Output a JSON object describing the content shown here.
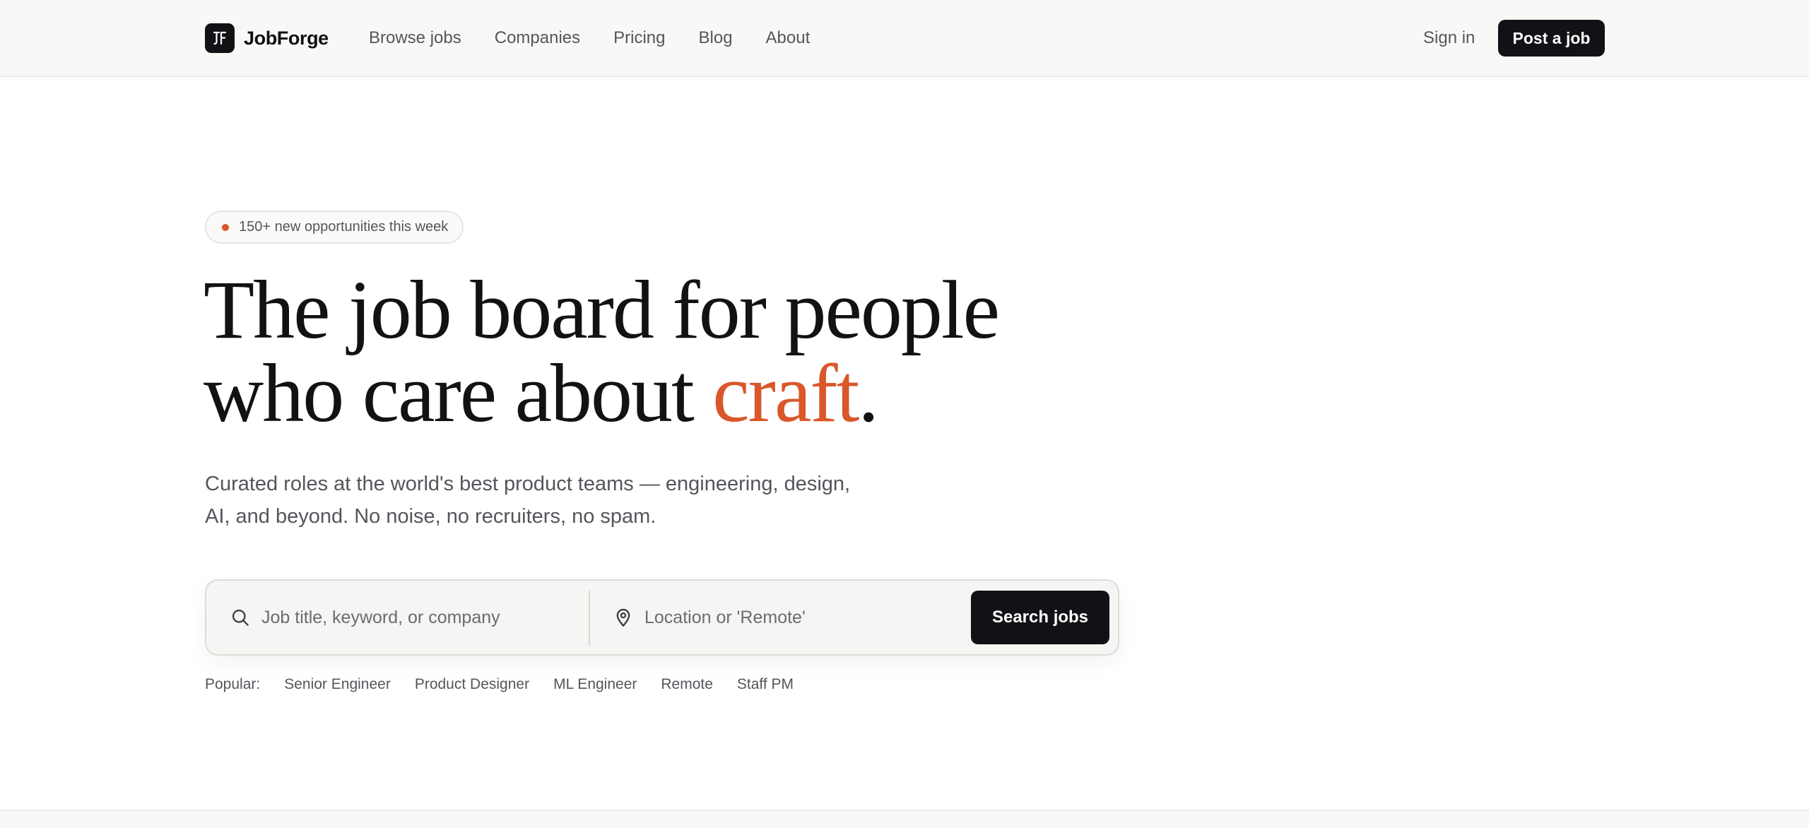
{
  "colors": {
    "accent": "#d9572a",
    "primary_dark": "#121216",
    "muted_text": "#55555c",
    "header_bg": "#f9f8f6"
  },
  "header": {
    "brand": {
      "logo_icon": "jf-monogram-icon",
      "name": "JobForge"
    },
    "nav": [
      {
        "label": "Browse jobs"
      },
      {
        "label": "Companies"
      },
      {
        "label": "Pricing"
      },
      {
        "label": "Blog"
      },
      {
        "label": "About"
      }
    ],
    "sign_in": "Sign in",
    "post_job": "Post a job"
  },
  "hero": {
    "badge": "150+ new opportunities this week",
    "headline_line1": "The job board for people",
    "headline_line2_pre": "who care about ",
    "headline_accent": "craft",
    "headline_end": ".",
    "subhead_line1": "Curated roles at the world's best product teams — engineering, design,",
    "subhead_line2": "AI, and beyond. No noise, no recruiters, no spam."
  },
  "search": {
    "keyword_icon": "search-icon",
    "keyword_placeholder": "Job title, keyword, or company",
    "keyword_value": "",
    "location_icon": "map-pin-icon",
    "location_placeholder": "Location or 'Remote'",
    "location_value": "",
    "button": "Search jobs"
  },
  "popular": {
    "label": "Popular:",
    "tags": [
      "Senior Engineer",
      "Product Designer",
      "ML Engineer",
      "Remote",
      "Staff PM"
    ]
  }
}
